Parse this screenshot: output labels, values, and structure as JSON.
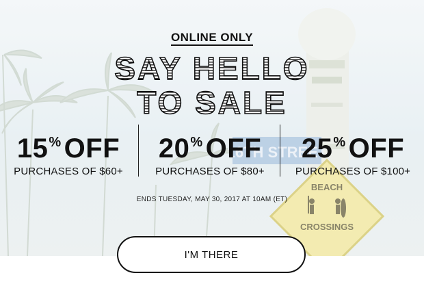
{
  "promo": {
    "eyebrow": "ONLINE ONLY",
    "headline_line1": "SAY HELLO",
    "headline_line2": "TO SALE",
    "offers": [
      {
        "percent": "15",
        "suffix": "OFF",
        "condition": "PURCHASES OF $60+"
      },
      {
        "percent": "20",
        "suffix": "OFF",
        "condition": "PURCHASES OF $80+"
      },
      {
        "percent": "25",
        "suffix": "OFF",
        "condition": "PURCHASES OF $100+"
      }
    ],
    "percent_sign": "%",
    "ends_text": "ENDS TUESDAY, MAY 30, 2017 AT 10AM (ET)",
    "cta_label": "I'M THERE"
  },
  "background": {
    "street_sign_text": "16TH STREET",
    "beach_sign_top": "BEACH",
    "beach_sign_bottom": "CROSSINGS"
  },
  "colors": {
    "sky": "#dfeaf0",
    "text": "#111111",
    "sign_yellow": "#f3ea9c",
    "street_sign_blue": "#8fb1d6"
  }
}
